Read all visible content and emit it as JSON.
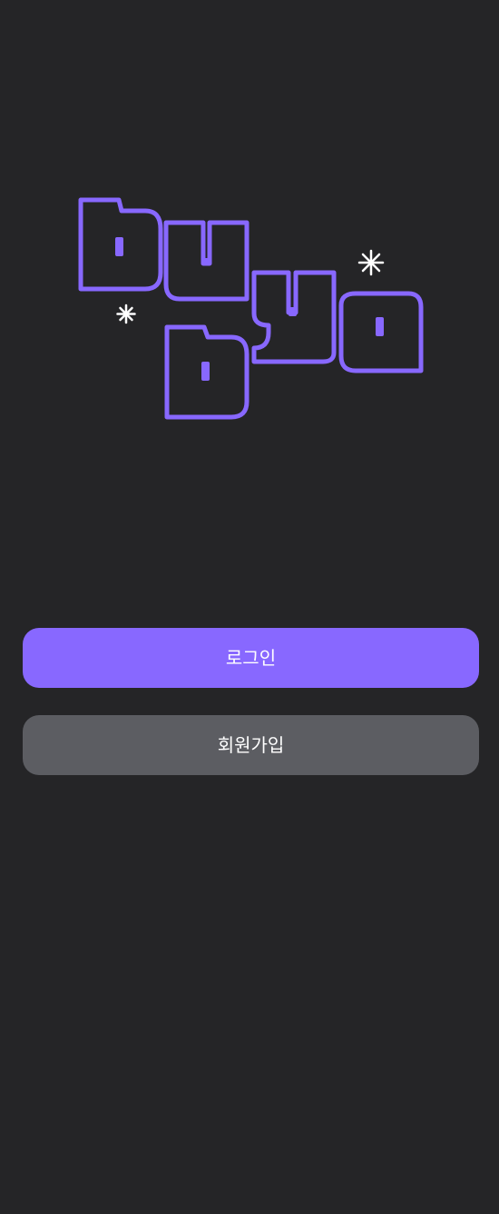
{
  "app": {
    "logo_alt": "buybo"
  },
  "colors": {
    "background": "#252527",
    "accent": "#8868FF",
    "secondary_button": "#5C5D62",
    "text": "#FFFFFF"
  },
  "actions": {
    "login_label": "로그인",
    "signup_label": "회원가입"
  }
}
